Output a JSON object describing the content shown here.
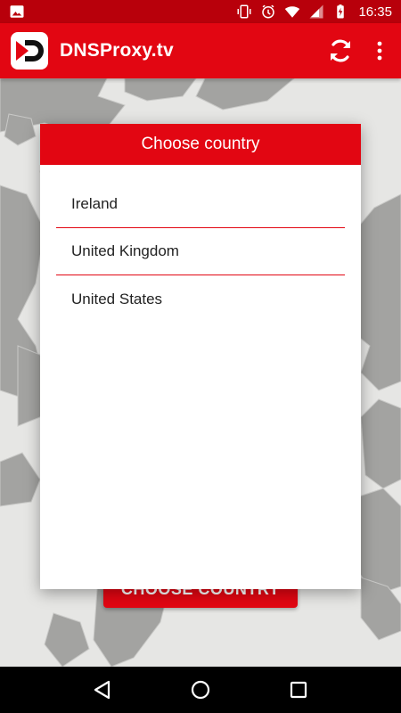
{
  "status_bar": {
    "time": "16:35",
    "icons": [
      "image-icon",
      "vibrate-icon",
      "alarm-icon",
      "wifi-icon",
      "signal-icon",
      "battery-charging-icon"
    ]
  },
  "app_bar": {
    "title": "DNSProxy.tv",
    "logo": "dnsproxy-logo",
    "actions": [
      "refresh-icon",
      "more-vert-icon"
    ]
  },
  "background": {
    "button_label": "CHOOSE COUNTRY"
  },
  "dialog": {
    "title": "Choose country",
    "countries": [
      "Ireland",
      "United Kingdom",
      "United States"
    ]
  },
  "nav_bar": {
    "buttons": [
      "back-icon",
      "home-icon",
      "recents-icon"
    ]
  },
  "colors": {
    "accent": "#e20612",
    "status_bar": "#b8000b",
    "land": "#a3a3a1",
    "sea": "#e6e6e4"
  }
}
